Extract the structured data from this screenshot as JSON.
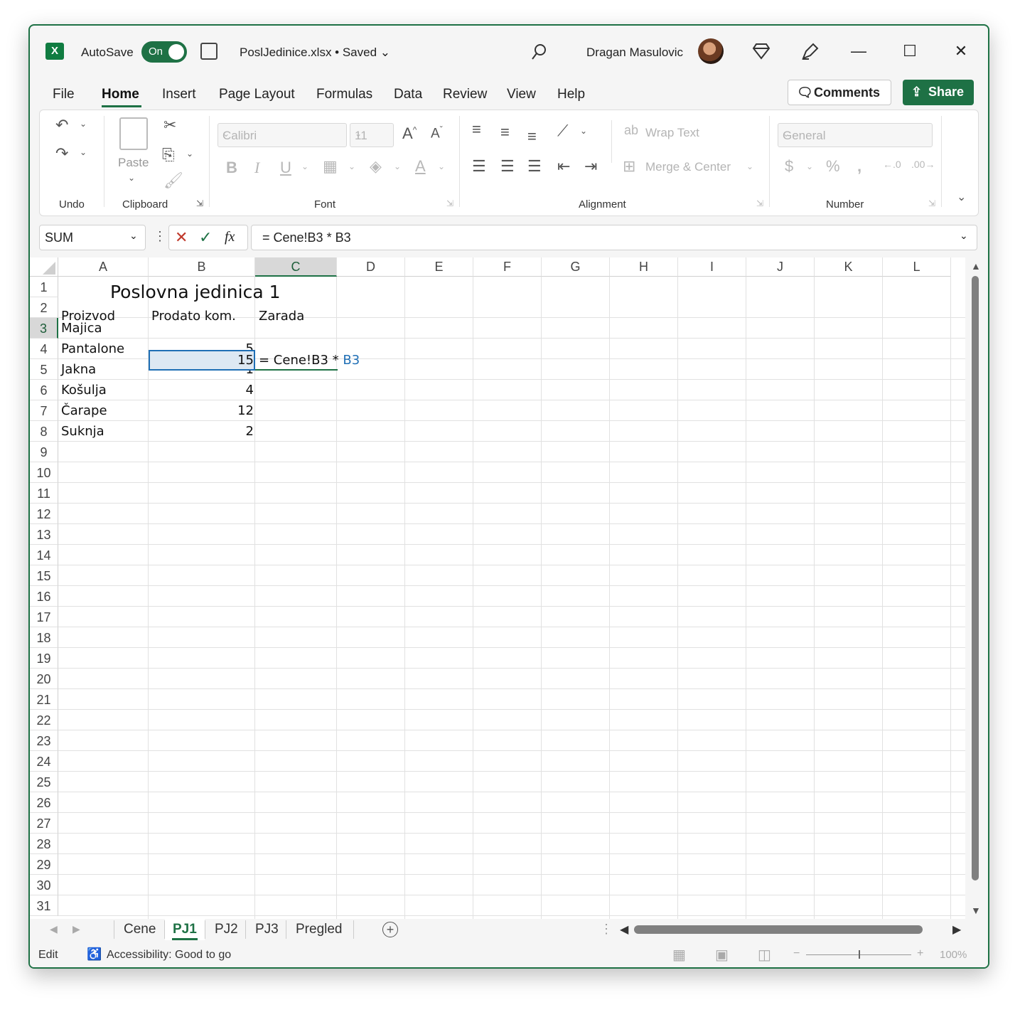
{
  "titlebar": {
    "autosave_label": "AutoSave",
    "autosave_state": "On",
    "doc_title": "PoslJedinice.xlsx • Saved",
    "user_name": "Dragan Masulovic"
  },
  "menu": {
    "tabs": [
      "File",
      "Home",
      "Insert",
      "Page Layout",
      "Formulas",
      "Data",
      "Review",
      "View",
      "Help"
    ],
    "active": "Home",
    "comments_label": "Comments",
    "share_label": "Share"
  },
  "ribbon": {
    "groups": {
      "undo": "Undo",
      "clipboard": "Clipboard",
      "font": "Font",
      "alignment": "Alignment",
      "number": "Number"
    },
    "paste_label": "Paste",
    "font_name": "Calibri",
    "font_size": "11",
    "wrap_text": "Wrap Text",
    "merge_center": "Merge & Center",
    "number_format": "General"
  },
  "formula_bar": {
    "name_box": "SUM",
    "formula": "= Cene!B3 * B3",
    "fx": "fx"
  },
  "grid": {
    "columns": [
      "A",
      "B",
      "C",
      "D",
      "E",
      "F",
      "G",
      "H",
      "I",
      "J",
      "K",
      "L"
    ],
    "selected_column": "C",
    "rows": [
      "1",
      "2",
      "3",
      "4",
      "5",
      "6",
      "7",
      "8",
      "9",
      "10",
      "11",
      "12",
      "13",
      "14",
      "15",
      "16",
      "17",
      "18",
      "19",
      "20",
      "21",
      "22",
      "23",
      "24",
      "25",
      "26",
      "27",
      "28",
      "29",
      "30",
      "31"
    ],
    "selected_row": "3",
    "title": "Poslovna jedinica 1",
    "headers": [
      "Proizvod",
      "Prodato kom.",
      "Zarada"
    ],
    "products": [
      "Majica",
      "Pantalone",
      "Jakna",
      "Košulja",
      "Čarape",
      "Suknja"
    ],
    "quantities": [
      "15",
      "5",
      "1",
      "4",
      "12",
      "2"
    ],
    "edit_text_prefix": "= Cene!B3 * ",
    "edit_text_ref": "B3"
  },
  "sheets": {
    "tabs": [
      "Cene",
      "PJ1",
      "PJ2",
      "PJ3",
      "Pregled"
    ],
    "active": "PJ1"
  },
  "status": {
    "mode": "Edit",
    "accessibility": "Accessibility: Good to go",
    "zoom": "100%"
  },
  "colors": {
    "accent": "#1e7145",
    "reference_blue": "#1f6fb5"
  }
}
